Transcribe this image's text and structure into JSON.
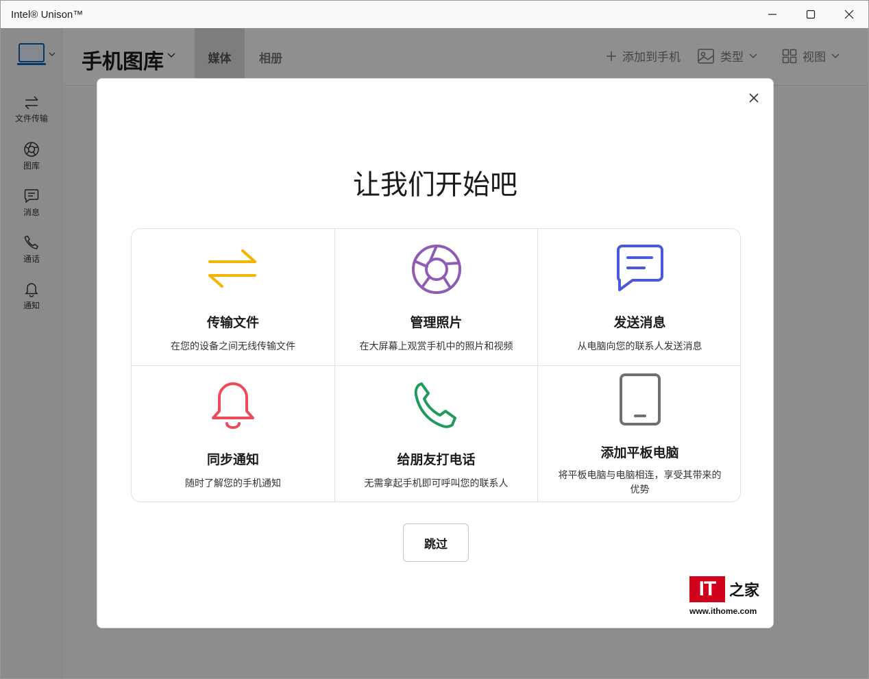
{
  "window": {
    "title": "Intel® Unison™"
  },
  "leftnav": {
    "items": [
      {
        "label": "文件传输",
        "icon": "transfer-icon"
      },
      {
        "label": "图库",
        "icon": "gallery-icon"
      },
      {
        "label": "消息",
        "icon": "message-icon"
      },
      {
        "label": "通话",
        "icon": "phone-icon"
      },
      {
        "label": "通知",
        "icon": "bell-icon"
      }
    ]
  },
  "topbar": {
    "title": "手机图库",
    "tabs": [
      {
        "label": "媒体",
        "active": true
      },
      {
        "label": "相册",
        "active": false
      }
    ],
    "add_to_phone": "添加到手机",
    "type_label": "类型",
    "view_label": "视图"
  },
  "dialog": {
    "title": "让我们开始吧",
    "cards": [
      {
        "title": "传输文件",
        "desc": "在您的设备之间无线传输文件",
        "icon": "transfer-icon",
        "color": "#f5b400"
      },
      {
        "title": "管理照片",
        "desc": "在大屏幕上观赏手机中的照片和视频",
        "icon": "aperture-icon",
        "color": "#8e5bb5"
      },
      {
        "title": "发送消息",
        "desc": "从电脑向您的联系人发送消息",
        "icon": "message-icon",
        "color": "#4a57e0"
      },
      {
        "title": "同步通知",
        "desc": "随时了解您的手机通知",
        "icon": "bell-icon",
        "color": "#ef4a5a"
      },
      {
        "title": "给朋友打电话",
        "desc": "无需拿起手机即可呼叫您的联系人",
        "icon": "phone-icon",
        "color": "#1f9a5a"
      },
      {
        "title": "添加平板电脑",
        "desc": "将平板电脑与电脑相连，享受其带来的优势",
        "icon": "tablet-icon",
        "color": "#707070"
      }
    ],
    "skip_label": "跳过"
  },
  "watermark": {
    "logo_text": "IT",
    "glyph": "之家",
    "url": "www.ithome.com"
  }
}
